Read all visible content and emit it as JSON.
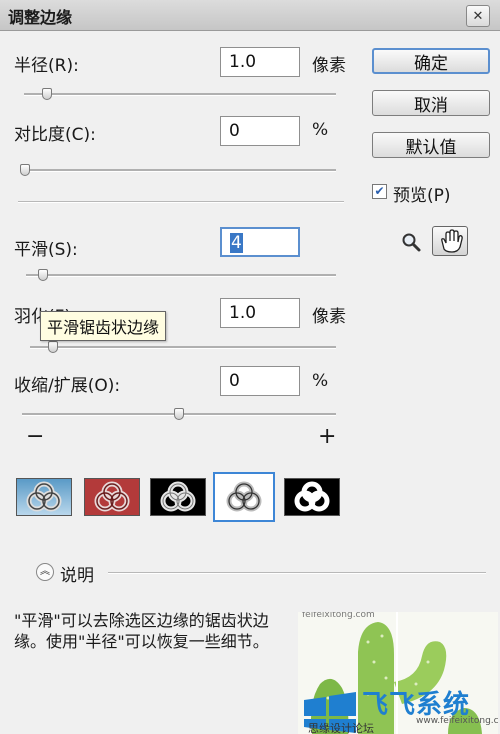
{
  "window": {
    "title": "调整边缘",
    "close_symbol": "✕"
  },
  "controls": {
    "radius": {
      "label": "半径(R):",
      "value": "1.0",
      "unit": "像素",
      "slider_level": 0.06
    },
    "contrast": {
      "label": "对比度(C):",
      "value": "0",
      "unit": "%",
      "slider_level": 0.0
    },
    "smooth": {
      "label": "平滑(S):",
      "value": "4",
      "slider_level": 0.04
    },
    "feather": {
      "label": "羽化(F):",
      "value": "1.0",
      "unit": "像素",
      "slider_level": 0.06
    },
    "shrink": {
      "label": "收缩/扩展(O):",
      "value": "0",
      "unit": "%",
      "slider_level": 0.5,
      "minus": "−",
      "plus": "+"
    }
  },
  "buttons": {
    "ok": "确定",
    "cancel": "取消",
    "default": "默认值"
  },
  "preview": {
    "label": "预览(P)",
    "checked": true,
    "check_mark": "✔"
  },
  "tools": [
    "zoom-icon",
    "hand-icon"
  ],
  "tooltip": "平滑锯齿状边缘",
  "view_modes": [
    "standard",
    "quick-mask",
    "on-black",
    "on-white",
    "mask"
  ],
  "selected_view": 3,
  "info": {
    "heading": "说明",
    "text": "\"平滑\"可以去除选区边缘的锯齿状边缘。使用\"半径\"可以恢复一些细节。"
  },
  "watermark": {
    "brand": "飞飞系统",
    "url": "www.feifeixitong.com",
    "url_alt": "feifeixitong.com",
    "forum_line": "思缘设计论坛"
  },
  "colors": {
    "accent": "#3d86d6",
    "tooltip_bg": "#fffde1",
    "brand_blue": "#1f7fd0"
  }
}
